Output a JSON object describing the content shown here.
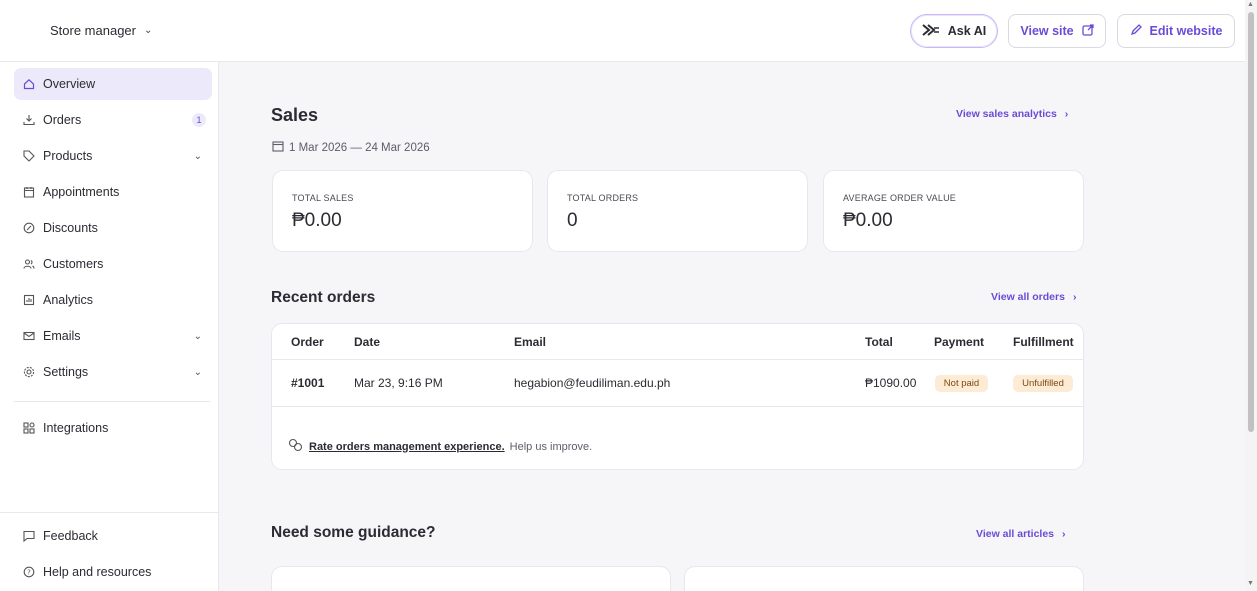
{
  "topbar": {
    "store_label": "Store manager",
    "ask_ai_label": "Ask AI",
    "view_site_label": "View site",
    "edit_website_label": "Edit website"
  },
  "sidebar": {
    "items": [
      {
        "label": "Overview",
        "icon": "home-icon",
        "active": true
      },
      {
        "label": "Orders",
        "icon": "download-icon",
        "badge": "1"
      },
      {
        "label": "Products",
        "icon": "tag-icon",
        "expandable": true
      },
      {
        "label": "Appointments",
        "icon": "calendar-icon"
      },
      {
        "label": "Discounts",
        "icon": "discount-icon"
      },
      {
        "label": "Customers",
        "icon": "users-icon"
      },
      {
        "label": "Analytics",
        "icon": "chart-icon"
      },
      {
        "label": "Emails",
        "icon": "mail-icon",
        "expandable": true
      },
      {
        "label": "Settings",
        "icon": "gear-icon",
        "expandable": true
      }
    ],
    "integrations_label": "Integrations",
    "feedback_label": "Feedback",
    "help_label": "Help and resources"
  },
  "sales": {
    "title": "Sales",
    "analytics_link": "View sales analytics",
    "date_range": "1 Mar 2026 — 24 Mar 2026",
    "cards": [
      {
        "label": "TOTAL SALES",
        "value": "₱0.00"
      },
      {
        "label": "TOTAL ORDERS",
        "value": "0"
      },
      {
        "label": "AVERAGE ORDER VALUE",
        "value": "₱0.00"
      }
    ]
  },
  "recent_orders": {
    "title": "Recent orders",
    "view_all_link": "View all orders",
    "columns": [
      "Order",
      "Date",
      "Email",
      "Total",
      "Payment",
      "Fulfillment"
    ],
    "rows": [
      {
        "order": "#1001",
        "date": "Mar 23, 9:16 PM",
        "email": "hegabion@feudiliman.edu.ph",
        "total": "₱1090.00",
        "payment": "Not paid",
        "fulfillment": "Unfulfilled"
      }
    ],
    "rate_link": "Rate orders management experience.",
    "rate_suffix": "Help us improve."
  },
  "guidance": {
    "title": "Need some guidance?",
    "view_all_link": "View all articles"
  },
  "colors": {
    "accent": "#6b4bd6",
    "active_bg": "#ece9fb",
    "pill_bg": "#fdebd6"
  }
}
